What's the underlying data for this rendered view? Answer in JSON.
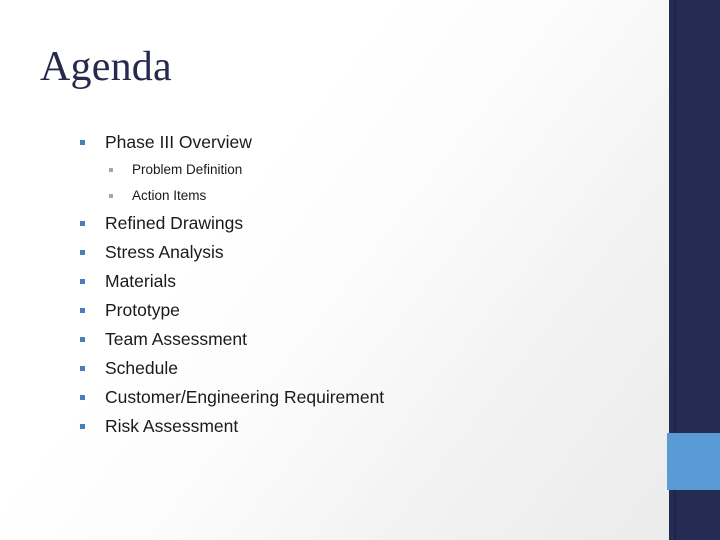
{
  "slide": {
    "title": "Agenda",
    "colors": {
      "title_text": "#262B4D",
      "body_text": "#1A1A1A",
      "level1_bullet": "#4A7EBB",
      "level2_bullet": "#A6A6A6",
      "side_bar": "#262B54",
      "accent_block": "#5B9BD5",
      "background_start": "#FFFFFF",
      "background_end": "#EAEAEA"
    },
    "outline": [
      {
        "level": 1,
        "text": "Phase III Overview"
      },
      {
        "level": 2,
        "text": "Problem Definition"
      },
      {
        "level": 2,
        "text": "Action Items"
      },
      {
        "level": 1,
        "text": "Refined Drawings"
      },
      {
        "level": 1,
        "text": "Stress Analysis"
      },
      {
        "level": 1,
        "text": "Materials"
      },
      {
        "level": 1,
        "text": "Prototype"
      },
      {
        "level": 1,
        "text": "Team Assessment"
      },
      {
        "level": 1,
        "text": "Schedule"
      },
      {
        "level": 1,
        "text": "Customer/Engineering Requirement"
      },
      {
        "level": 1,
        "text": "Risk Assessment"
      }
    ]
  }
}
